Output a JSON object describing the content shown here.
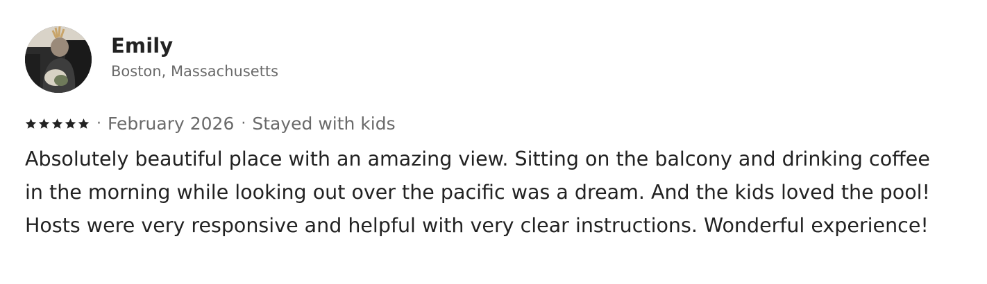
{
  "reviewer": {
    "name": "Emily",
    "location": "Boston, Massachusetts",
    "avatar_icon": "user-photo-avatar"
  },
  "rating": {
    "stars": 5,
    "max": 5,
    "star_color": "#222222",
    "separator": "·"
  },
  "meta": {
    "date": "February 2026",
    "trip_type": "Stayed with kids"
  },
  "review": {
    "text": "Absolutely beautiful place with an amazing view. Sitting on the balcony and drinking coffee\nin the morning while looking out over the pacific was a dream. And the kids loved the pool!\nHosts were very responsive and helpful with very clear instructions. Wonderful experience!"
  },
  "colors": {
    "primary_text": "#222222",
    "secondary_text": "#6a6a6a",
    "background": "#ffffff"
  }
}
